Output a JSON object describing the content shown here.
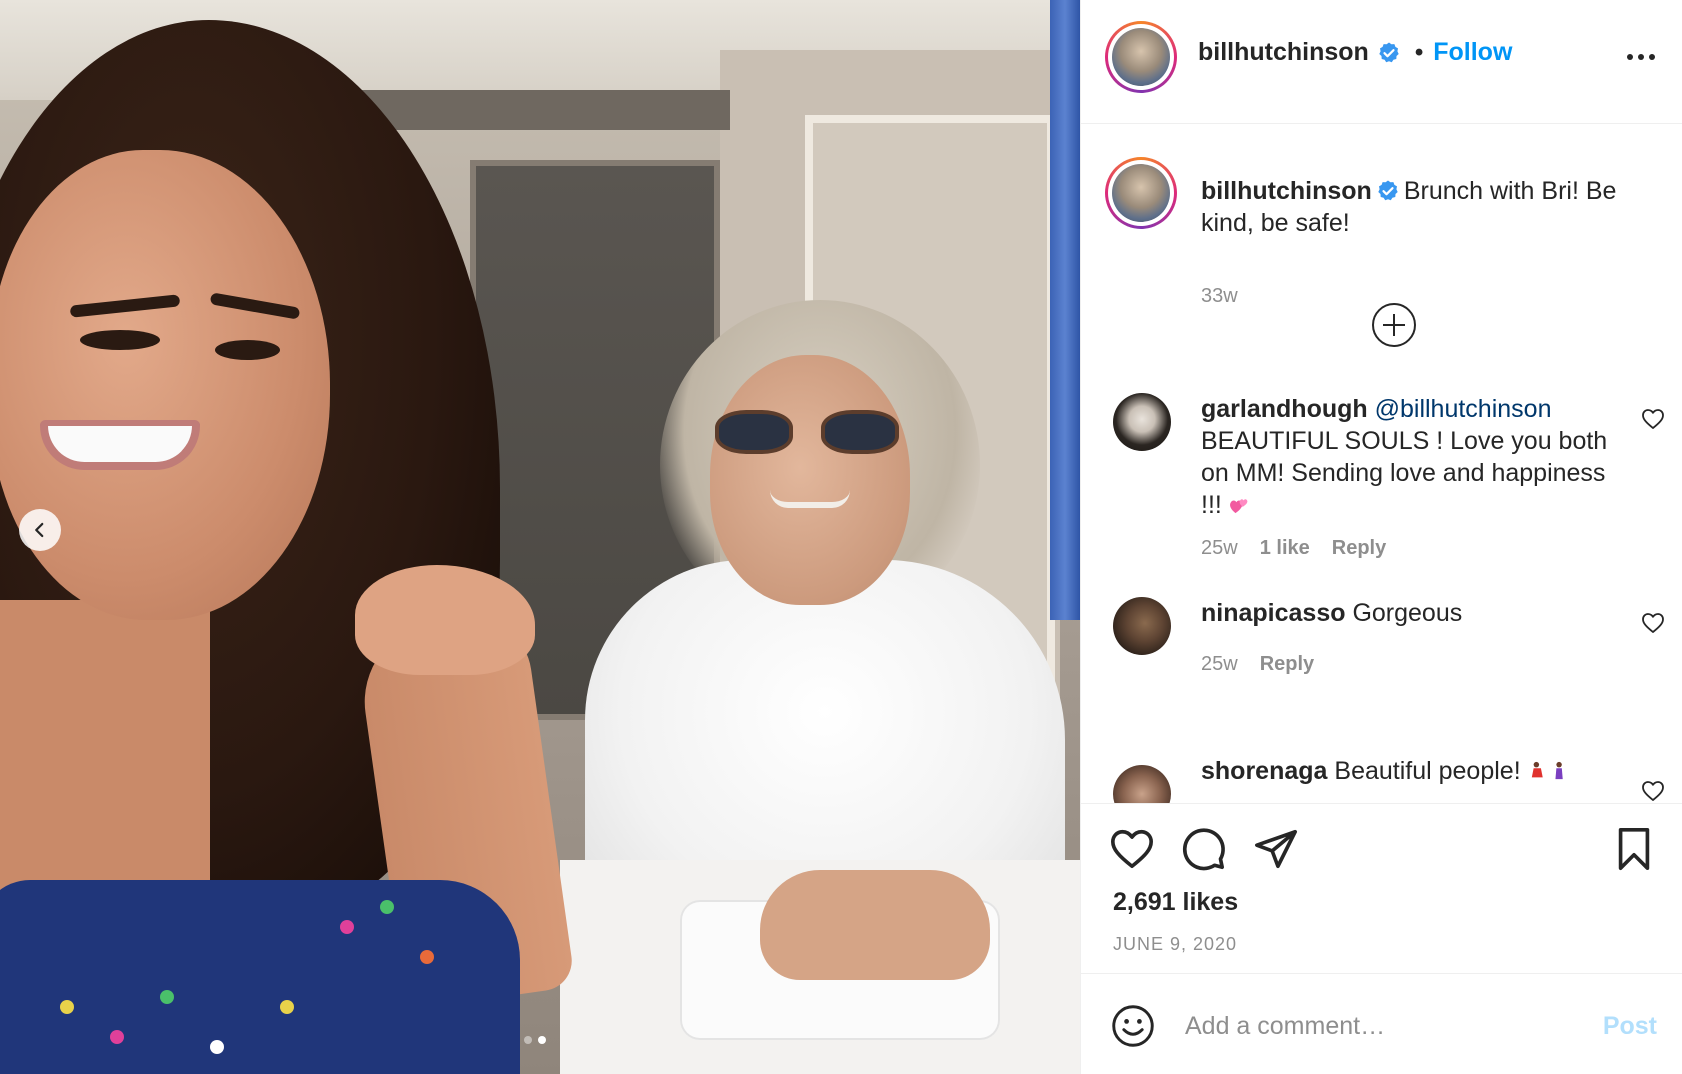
{
  "post": {
    "username": "billhutchinson",
    "verified": true,
    "follow_label": "Follow",
    "separator": "•",
    "carousel": {
      "slides": 2,
      "current": 2
    }
  },
  "caption": {
    "username": "billhutchinson",
    "text": "Brunch with Bri! Be kind, be safe!",
    "time": "33w"
  },
  "comments": [
    {
      "username": "garlandhough",
      "mention": "@billhutchinson",
      "text": "BEAUTIFUL SOULS ! Love you both on MM! Sending love and happiness !!!",
      "emoji": "two-hearts",
      "time": "25w",
      "likes": "1 like",
      "reply": "Reply"
    },
    {
      "username": "ninapicasso",
      "text": "Gorgeous",
      "time": "25w",
      "reply": "Reply"
    },
    {
      "username": "shorenaga",
      "text": "Beautiful people!",
      "emoji": "dancer-emojis"
    }
  ],
  "actions": {
    "likes": "2,691 likes",
    "date": "JUNE 9, 2020"
  },
  "add_comment": {
    "placeholder": "Add a comment…",
    "post_label": "Post"
  },
  "colors": {
    "accent": "#0095f6",
    "mention": "#00376b",
    "muted": "#8e8e8e",
    "post_disabled": "#b2dffc",
    "verified": "#3897f0"
  }
}
